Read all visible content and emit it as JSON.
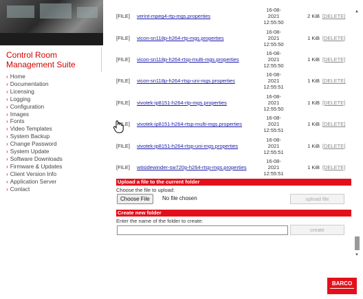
{
  "header": {
    "suite_title": "Control Room Management Suite"
  },
  "nav": [
    "Home",
    "Documentation",
    "Licensing",
    "Logging",
    "Configuration",
    "Images",
    "Fonts",
    "Video Templates",
    "System Backup",
    "Change Password",
    "System Update",
    "Software Downloads",
    "Firmware & Updates",
    "Client Version Info",
    "Application Server",
    "Contact"
  ],
  "files": [
    {
      "type": "[FILE]",
      "name": "verint-mpeg4-rtp-mgs.properties",
      "date": "16-08-",
      "date2": "2021",
      "time": "12:55:50",
      "size": "2 KiB",
      "delete": "[DELETE]"
    },
    {
      "type": "[FILE]",
      "name": "vicon-sn118p-h264-rtp-mgs.properties",
      "date": "16-08-",
      "date2": "2021",
      "time": "12:55:50",
      "size": "1 KiB",
      "delete": "[DELETE]"
    },
    {
      "type": "[FILE]",
      "name": "vicon-sn118p-h264-rtsp-multi-mgs.properties",
      "date": "16-08-",
      "date2": "2021",
      "time": "12:55:50",
      "size": "1 KiB",
      "delete": "[DELETE]"
    },
    {
      "type": "[FILE]",
      "name": "vicon-sn118p-h264-rtsp-uni-mgs.properties",
      "date": "16-08-",
      "date2": "2021",
      "time": "12:55:51",
      "size": "1 KiB",
      "delete": "[DELETE]"
    },
    {
      "type": "[FILE]",
      "name": "vivotek-ip8151-h264-rtp-mgs.properties",
      "date": "16-08-",
      "date2": "2021",
      "time": "12:55:50",
      "size": "1 KiB",
      "delete": "[DELETE]"
    },
    {
      "type": "[FILE]",
      "name": "vivotek-ip8151-h264-rtsp-multi-mgs.properties",
      "date": "16-08-",
      "date2": "2021",
      "time": "12:55:51",
      "size": "1 KiB",
      "delete": "[DELETE]"
    },
    {
      "type": "[FILE]",
      "name": "vivotek-ip8151-h264-rtsp-uni-mgs.properties",
      "date": "16-08-",
      "date2": "2021",
      "time": "12:55:51",
      "size": "1 KiB",
      "delete": "[DELETE]"
    },
    {
      "type": "[FILE]",
      "name": "wtisidewinder-sw720p-h264-rtsp-mgs.properties",
      "date": "16-08-",
      "date2": "2021",
      "time": "12:55:51",
      "size": "1 KiB",
      "delete": "[DELETE]"
    }
  ],
  "upload": {
    "heading": "Upload a file to the current folder",
    "label": "Choose the file to upload:",
    "choose": "Choose File",
    "nofile": "No file chosen",
    "button": "upload file"
  },
  "create": {
    "heading": "Create new folder",
    "label": "Enter the name of the folder to create:",
    "button": "create"
  },
  "logo": "BARCO",
  "colors": {
    "accent": "#e3101b",
    "link": "#1a1aa8"
  }
}
